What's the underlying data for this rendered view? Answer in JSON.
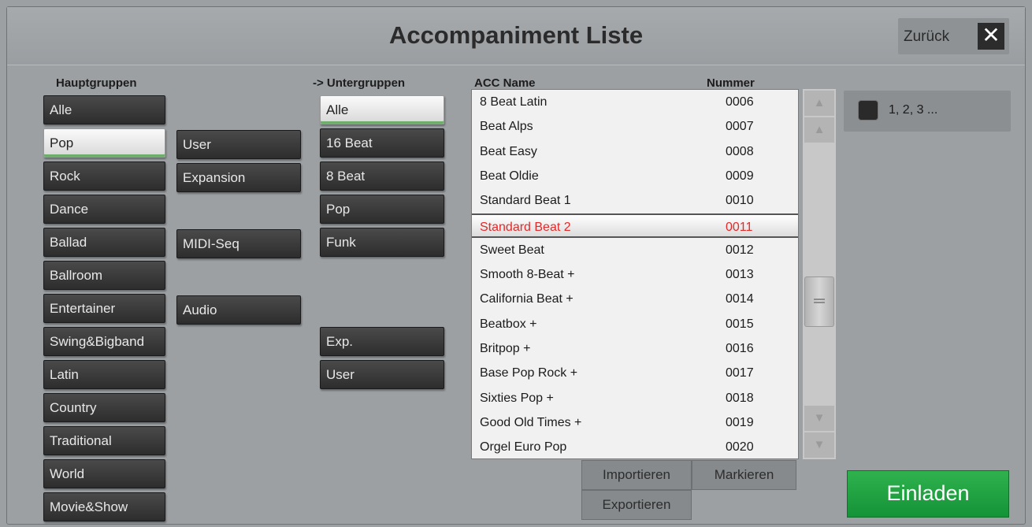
{
  "window": {
    "title": "Accompaniment Liste",
    "back_label": "Zurück",
    "close_glyph": "✕"
  },
  "columns": {
    "main": "Hauptgruppen",
    "sub": "-> Untergruppen",
    "acc_name": "ACC Name",
    "number": "Nummer"
  },
  "main_groups": [
    "Alle",
    "Pop",
    "Rock",
    "Dance",
    "Ballad",
    "Ballroom",
    "Entertainer",
    "Swing&Bigband",
    "Latin",
    "Country",
    "Traditional",
    "World",
    "Movie&Show"
  ],
  "main_groups_selected": "Pop",
  "source_groups": [
    "User",
    "Expansion",
    "MIDI-Seq",
    "Audio"
  ],
  "sub_groups": [
    "Alle",
    "16 Beat",
    "8 Beat",
    "Pop",
    "Funk",
    "Exp.",
    "User"
  ],
  "sub_groups_selected": "Alle",
  "list": [
    {
      "name": "8 Beat Latin",
      "num": "0006"
    },
    {
      "name": "Beat Alps",
      "num": "0007"
    },
    {
      "name": "Beat Easy",
      "num": "0008"
    },
    {
      "name": "Beat Oldie",
      "num": "0009"
    },
    {
      "name": "Standard Beat 1",
      "num": "0010"
    },
    {
      "name": "Standard Beat 2",
      "num": "0011"
    },
    {
      "name": "Sweet Beat",
      "num": "0012"
    },
    {
      "name": "Smooth 8-Beat +",
      "num": "0013"
    },
    {
      "name": "California Beat +",
      "num": "0014"
    },
    {
      "name": "Beatbox +",
      "num": "0015"
    },
    {
      "name": "Britpop +",
      "num": "0016"
    },
    {
      "name": "Base Pop Rock +",
      "num": "0017"
    },
    {
      "name": "Sixties Pop +",
      "num": "0018"
    },
    {
      "name": "Good Old Times +",
      "num": "0019"
    },
    {
      "name": "Orgel Euro Pop",
      "num": "0020"
    }
  ],
  "list_selected": "0011",
  "scroll_icons": {
    "top": "scroll-top-icon",
    "up": "scroll-up-icon",
    "down": "scroll-down-icon",
    "bottom": "scroll-bottom-icon"
  },
  "numbering_toggle": {
    "label": "1, 2, 3 ...",
    "checked": false
  },
  "actions": {
    "import": "Importieren",
    "mark": "Markieren",
    "export": "Exportieren",
    "load": "Einladen"
  },
  "colors": {
    "selected_text": "#e02b2b",
    "load_button": "#1ea443"
  }
}
